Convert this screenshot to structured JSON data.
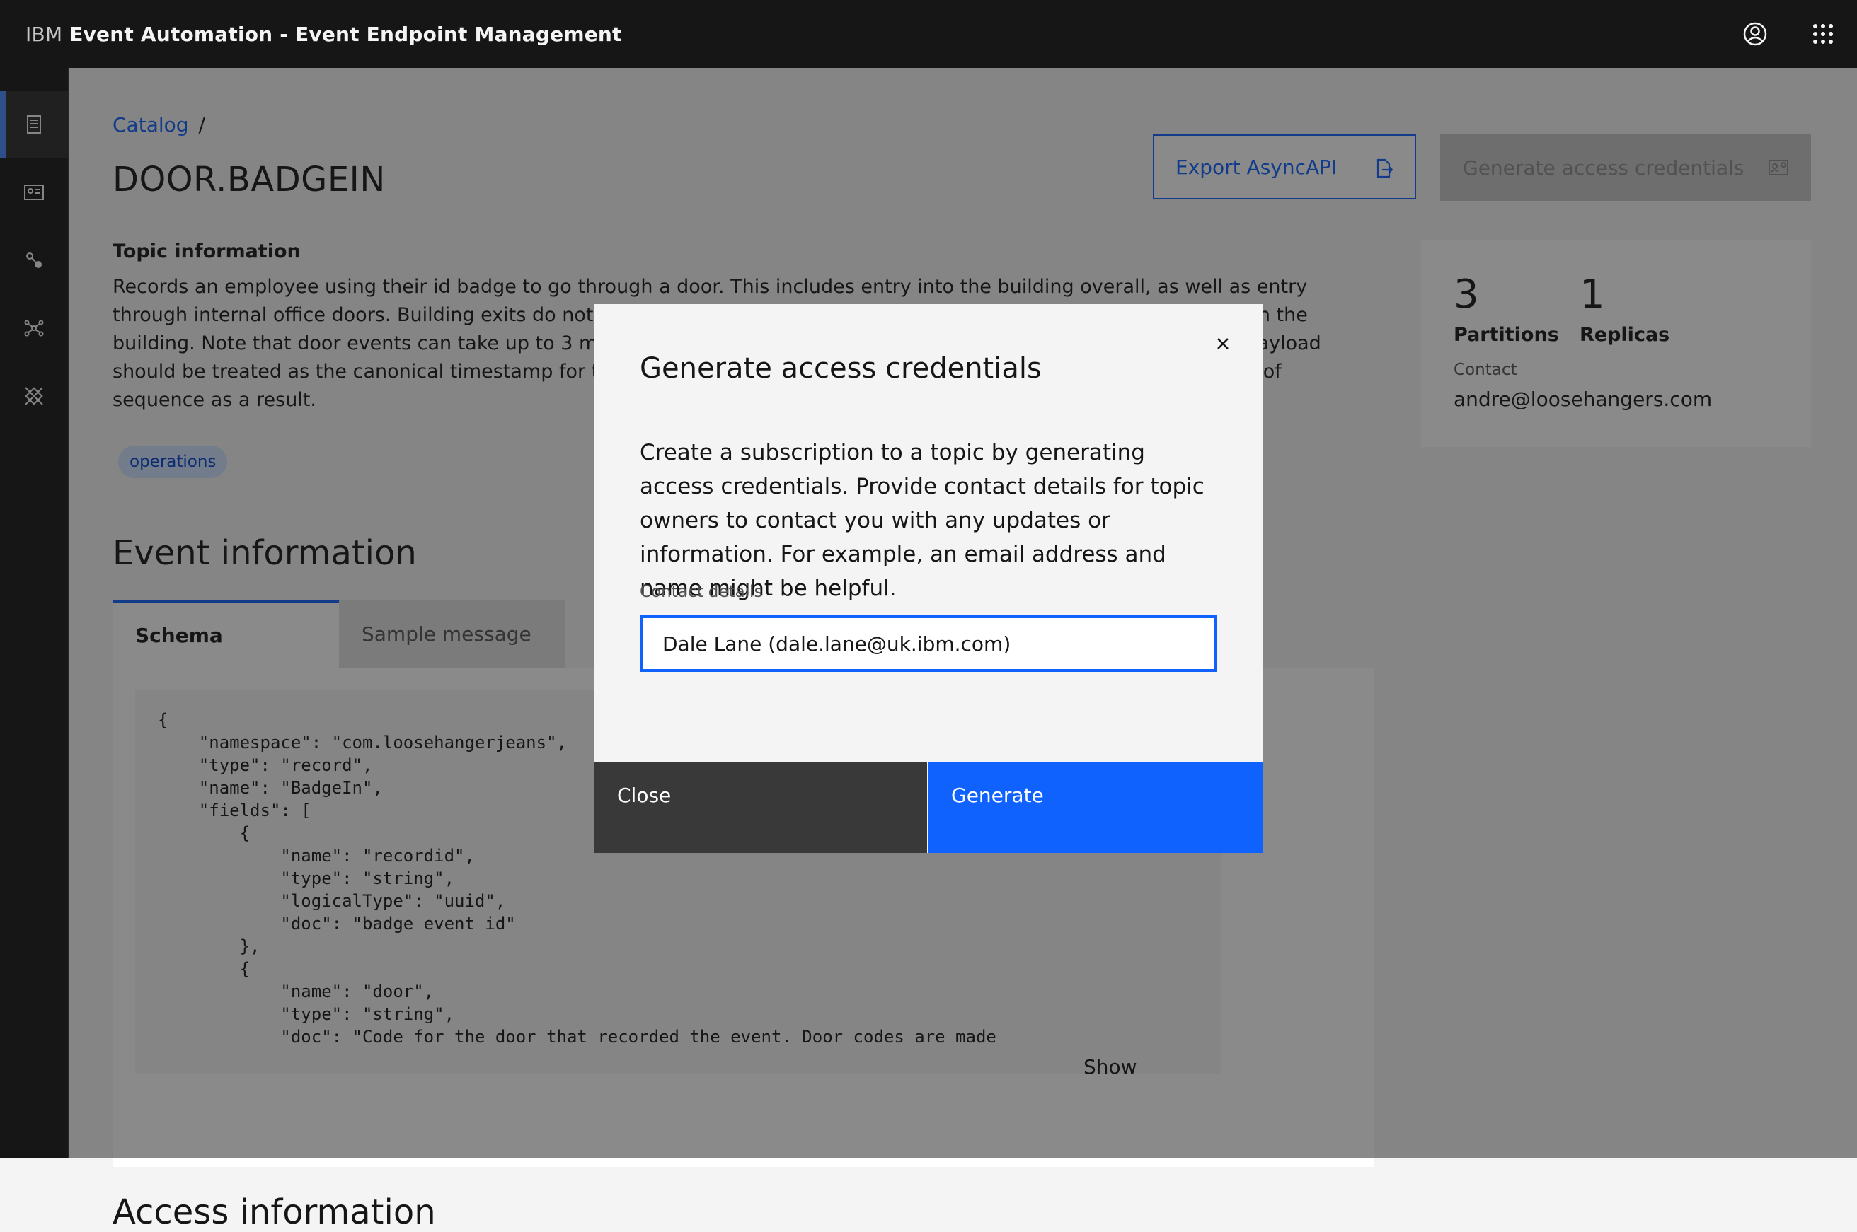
{
  "header": {
    "brand_prefix": "IBM",
    "brand_product": "Event Automation - Event Endpoint Management",
    "user_icon": "user-avatar-icon",
    "apps_icon": "app-switcher-icon"
  },
  "sidenav": {
    "items": [
      {
        "icon": "catalog-icon",
        "active": true
      },
      {
        "icon": "profile-card-icon",
        "active": false
      },
      {
        "icon": "connection-icon",
        "active": false
      },
      {
        "icon": "network-icon",
        "active": false
      },
      {
        "icon": "gateway-icon",
        "active": false
      }
    ],
    "expand_icon": "chevron-right-icon"
  },
  "breadcrumb": {
    "link": "Catalog",
    "separator": "/"
  },
  "page": {
    "title": "DOOR.BADGEIN",
    "export_label": "Export AsyncAPI",
    "generate_label": "Generate access credentials"
  },
  "topic": {
    "section_label": "Topic information",
    "description": "Records an employee using their id badge to go through a door. This includes entry into the building overall, as well as entry through internal office doors. Building exits do not require use of the badge, so people who have badged in will still be in the building. Note that door events can take up to 3 minutes to be processed, so the recorded timestamp in the message payload should be treated as the canonical timestamp for the event rather than the message timestamp. Messages may be out of sequence as a result.",
    "tag": "operations"
  },
  "stats": {
    "partitions_value": "3",
    "partitions_label": "Partitions",
    "replicas_value": "1",
    "replicas_label": "Replicas",
    "contact_label": "Contact",
    "contact_value": "andre@loosehangers.com"
  },
  "event": {
    "title": "Event information",
    "tab_schema": "Schema",
    "tab_sample": "Sample message",
    "schema_code": "{\n    \"namespace\": \"com.loosehangerjeans\",\n    \"type\": \"record\",\n    \"name\": \"BadgeIn\",\n    \"fields\": [\n        {\n            \"name\": \"recordid\",\n            \"type\": \"string\",\n            \"logicalType\": \"uuid\",\n            \"doc\": \"badge event id\"\n        },\n        {\n            \"name\": \"door\",\n            \"type\": \"string\",\n            \"doc\": \"Code for the door that recorded the event. Door codes are made",
    "show_more": "Show more"
  },
  "access": {
    "title": "Access information"
  },
  "modal": {
    "title": "Generate access credentials",
    "body": "Create a subscription to a topic by generating access credentials. Provide contact details for topic owners to contact you with any updates or information. For example, an email address and name might be helpful.",
    "field_label": "Contact details",
    "field_value": "Dale Lane (dale.lane@uk.ibm.com)",
    "close_label": "Close",
    "generate_label": "Generate"
  },
  "colors": {
    "primary": "#0f62fe",
    "header_bg": "#161616",
    "tag_bg": "#d0e2ff"
  }
}
